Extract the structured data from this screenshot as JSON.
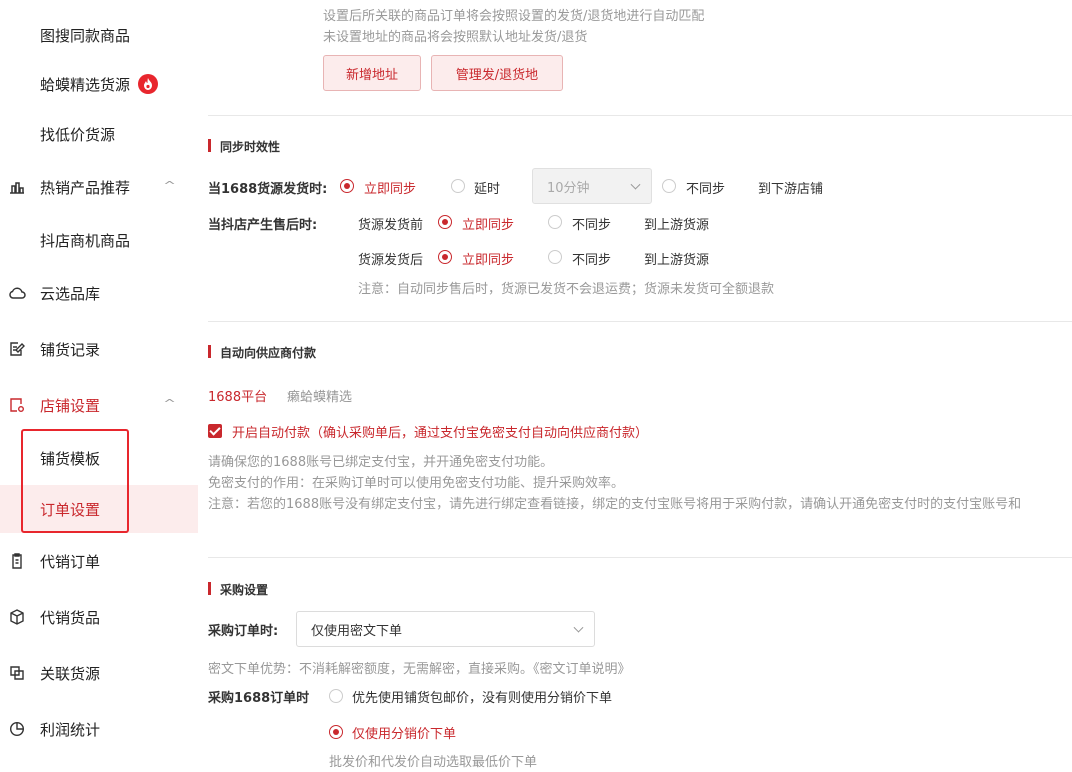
{
  "sidebar": {
    "items": [
      {
        "label": "图搜同款商品"
      },
      {
        "label": "蛤蟆精选货源"
      },
      {
        "label": "找低价货源"
      },
      {
        "label": "热销产品推荐"
      },
      {
        "label": "抖店商机商品"
      },
      {
        "label": "云选品库"
      },
      {
        "label": "铺货记录"
      },
      {
        "label": "店铺设置"
      },
      {
        "label": "铺货模板"
      },
      {
        "label": "订单设置"
      },
      {
        "label": "代销订单"
      },
      {
        "label": "代销货品"
      },
      {
        "label": "关联货源"
      },
      {
        "label": "利润统计"
      }
    ]
  },
  "address": {
    "note1": "设置后所关联的商品订单将会按照设置的发货/退货地进行自动匹配",
    "note2": "未设置地址的商品将会按照默认地址发货/退货",
    "add_button": "新增地址",
    "manage_button": "管理发/退货地"
  },
  "sync": {
    "title": "同步时效性",
    "row1_label": "当1688货源发货时:",
    "opt_immediate": "立即同步",
    "opt_delay": "延时",
    "delay_select": "10分钟",
    "opt_nosync": "不同步",
    "row1_target": "到下游店铺",
    "row2_label": "当抖店产生售后时:",
    "before_label": "货源发货前",
    "after_label": "货源发货后",
    "upstream_target": "到上游货源",
    "note": "注意：自动同步售后时，货源已发货不会退运费；货源未发货可全额退款"
  },
  "autopay": {
    "title": "自动向供应商付款",
    "tab1": "1688平台",
    "tab2": "癞蛤蟆精选",
    "checkbox_label": "开启自动付款（确认采购单后，通过支付宝免密支付自动向供应商付款）",
    "note1": "请确保您的1688账号已绑定支付宝，并开通免密支付功能。",
    "note2": "免密支付的作用：在采购订单时可以使用免密支付功能、提升采购效率。",
    "note3": "注意：若您的1688账号没有绑定支付宝，请先进行绑定查看链接，绑定的支付宝账号将用于采购付款，请确认开通免密支付时的支付宝账号和"
  },
  "purchase": {
    "title": "采购设置",
    "order_label": "采购订单时:",
    "order_select": "仅使用密文下单",
    "cipher_note": "密文下单优势：不消耗解密额度，无需解密，直接采购。《密文订单说明》",
    "price_label": "采购1688订单时",
    "price_opt1": "优先使用铺货包邮价，没有则使用分销价下单",
    "price_opt2": "仅使用分销价下单",
    "price_note": "批发价和代发价自动选取最低价下单"
  }
}
